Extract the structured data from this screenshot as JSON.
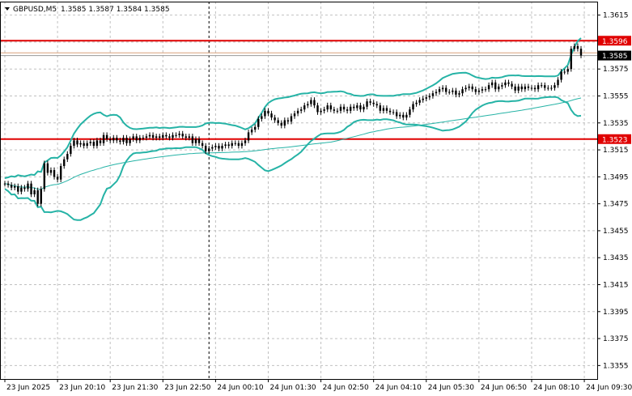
{
  "window": {
    "symbol_caption": "GBPUSD,M5",
    "ohlc_caption": "1.3585 1.3587 1.3584 1.3585"
  },
  "colors": {
    "background": "#ffffff",
    "grid": "#c0c0c0",
    "candle": "#000000",
    "bollinger": "#26b3a6",
    "ma": "#26b3a6",
    "level_line": "#e00000",
    "bid_line": "#9a9a9a",
    "ask_line": "#d9a07a",
    "badge_red": "#e00000",
    "badge_black": "#000000"
  },
  "chart_data": {
    "type": "candlestick",
    "symbol": "GBPUSD",
    "timeframe": "M5",
    "ylim": [
      1.3345,
      1.3625
    ],
    "yticks": [
      "1.3615",
      "1.3595",
      "1.3575",
      "1.3555",
      "1.3535",
      "1.3515",
      "1.3495",
      "1.3475",
      "1.3455",
      "1.3435",
      "1.3415",
      "1.3395",
      "1.3375",
      "1.3355"
    ],
    "xticks": [
      {
        "label": "23 Jun 2025",
        "i": 0
      },
      {
        "label": "23 Jun 20:10",
        "i": 16
      },
      {
        "label": "23 Jun 21:30",
        "i": 32
      },
      {
        "label": "23 Jun 22:50",
        "i": 48
      },
      {
        "label": "24 Jun 00:10",
        "i": 64
      },
      {
        "label": "24 Jun 01:30",
        "i": 80
      },
      {
        "label": "24 Jun 02:50",
        "i": 96
      },
      {
        "label": "24 Jun 04:10",
        "i": 112
      },
      {
        "label": "24 Jun 05:30",
        "i": 128
      },
      {
        "label": "24 Jun 06:50",
        "i": 144
      },
      {
        "label": "24 Jun 08:10",
        "i": 160
      },
      {
        "label": "24 Jun 09:30",
        "i": 176
      }
    ],
    "day_separator_index": 62,
    "levels": [
      {
        "label": "1.3596",
        "value": 1.3596,
        "style": "red"
      },
      {
        "label": "1.3523",
        "value": 1.3523,
        "style": "red"
      }
    ],
    "current_price": {
      "label": "1.3585",
      "value": 1.3585
    },
    "ask_price": {
      "value": 1.3587
    },
    "closes": [
      1.349,
      1.3489,
      1.3487,
      1.3488,
      1.3484,
      1.3487,
      1.3486,
      1.349,
      1.3482,
      1.3485,
      1.3475,
      1.3486,
      1.3505,
      1.3498,
      1.35,
      1.3495,
      1.3493,
      1.3503,
      1.3508,
      1.3512,
      1.3518,
      1.3522,
      1.3519,
      1.352,
      1.3518,
      1.352,
      1.3521,
      1.3518,
      1.3522,
      1.352,
      1.3526,
      1.3523,
      1.3522,
      1.3524,
      1.3522,
      1.3521,
      1.3524,
      1.352,
      1.3523,
      1.3525,
      1.3522,
      1.3524,
      1.3524,
      1.3525,
      1.3526,
      1.3524,
      1.3525,
      1.3524,
      1.3526,
      1.3525,
      1.3524,
      1.3526,
      1.3526,
      1.3527,
      1.3525,
      1.3524,
      1.3525,
      1.352,
      1.3523,
      1.352,
      1.3518,
      1.3514,
      1.3516,
      1.3517,
      1.3518,
      1.3516,
      1.3518,
      1.3519,
      1.3518,
      1.352,
      1.352,
      1.3518,
      1.352,
      1.3522,
      1.3528,
      1.353,
      1.3532,
      1.3538,
      1.354,
      1.3544,
      1.3542,
      1.3539,
      1.3537,
      1.3535,
      1.3533,
      1.3537,
      1.3536,
      1.354,
      1.3542,
      1.3544,
      1.3545,
      1.3548,
      1.3549,
      1.3552,
      1.3548,
      1.3543,
      1.3544,
      1.3545,
      1.3548,
      1.3545,
      1.3544,
      1.3544,
      1.3547,
      1.3545,
      1.3544,
      1.3547,
      1.3546,
      1.3548,
      1.3545,
      1.3547,
      1.3551,
      1.355,
      1.3549,
      1.3548,
      1.3544,
      1.3546,
      1.3544,
      1.3543,
      1.3543,
      1.354,
      1.3541,
      1.3539,
      1.3541,
      1.3545,
      1.3549,
      1.355,
      1.3552,
      1.3553,
      1.3554,
      1.3555,
      1.3557,
      1.3558,
      1.356,
      1.3561,
      1.3558,
      1.3558,
      1.3559,
      1.3556,
      1.3557,
      1.356,
      1.3561,
      1.3562,
      1.356,
      1.3558,
      1.3559,
      1.356,
      1.356,
      1.3563,
      1.3565,
      1.356,
      1.3562,
      1.3563,
      1.3565,
      1.3564,
      1.3562,
      1.3559,
      1.3562,
      1.356,
      1.3562,
      1.3561,
      1.3561,
      1.356,
      1.3563,
      1.3563,
      1.3561,
      1.3561,
      1.3561,
      1.3563,
      1.3567,
      1.3573,
      1.3573,
      1.3575,
      1.359,
      1.3592,
      1.359,
      1.3585
    ]
  }
}
